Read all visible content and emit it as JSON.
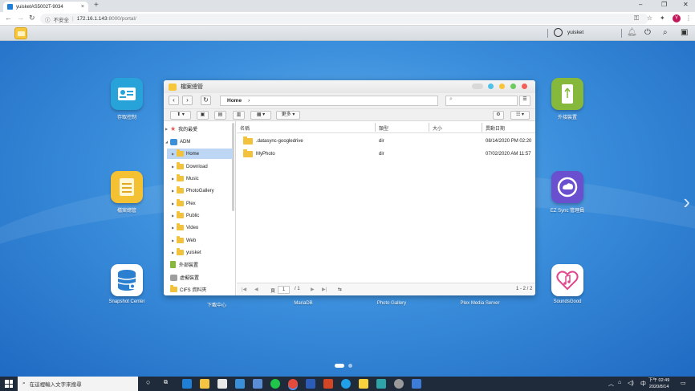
{
  "browser": {
    "tab_title": "yuisketAS5002T-9034",
    "tab_close": "×",
    "new_tab": "+",
    "security_label": "不安全",
    "url_host": "172.16.1.143",
    "url_path": ":8000/portal/",
    "profile_initial": "Y",
    "win_controls": [
      "–",
      "❐",
      "✕"
    ]
  },
  "adm": {
    "username": "yuisket"
  },
  "desktop": {
    "apps": [
      {
        "label": "存取控制",
        "color": "#27a3d9"
      },
      {
        "label": "檔案總管",
        "color": "#f4c132"
      },
      {
        "label": "Snapshot Center",
        "color": "#2a7fd1"
      },
      {
        "label": "外接裝置",
        "color": "#86b83c"
      },
      {
        "label": "EZ Sync 管理員",
        "color": "#6a4fcf"
      },
      {
        "label": "SoundsGood",
        "color": "#ffffff"
      },
      {
        "label": "下載中心",
        "color": ""
      },
      {
        "label": "MariaDB",
        "color": ""
      },
      {
        "label": "Photo Gallery",
        "color": ""
      },
      {
        "label": "Plex Media Server",
        "color": ""
      }
    ],
    "next_arrow": "›"
  },
  "explorer": {
    "title": "檔案總管",
    "path_label": "Home",
    "path_arrow": "›",
    "more_button": "更多",
    "tree": [
      {
        "label": "我的最愛",
        "level": 0,
        "selected": false,
        "kind": "star"
      },
      {
        "label": "ADM",
        "level": 0,
        "selected": false,
        "kind": "adm"
      },
      {
        "label": "Home",
        "level": 1,
        "selected": true,
        "kind": "folder"
      },
      {
        "label": "Download",
        "level": 1,
        "selected": false,
        "kind": "folder"
      },
      {
        "label": "Music",
        "level": 1,
        "selected": false,
        "kind": "folder"
      },
      {
        "label": "PhotoGallery",
        "level": 1,
        "selected": false,
        "kind": "folder"
      },
      {
        "label": "Plex",
        "level": 1,
        "selected": false,
        "kind": "folder"
      },
      {
        "label": "Public",
        "level": 1,
        "selected": false,
        "kind": "folder"
      },
      {
        "label": "Video",
        "level": 1,
        "selected": false,
        "kind": "folder"
      },
      {
        "label": "Web",
        "level": 1,
        "selected": false,
        "kind": "folder"
      },
      {
        "label": "yuisket",
        "level": 1,
        "selected": false,
        "kind": "folder"
      },
      {
        "label": "外部裝置",
        "level": 0,
        "selected": false,
        "kind": "ext"
      },
      {
        "label": "虛擬裝置",
        "level": 0,
        "selected": false,
        "kind": "virt"
      },
      {
        "label": "CIFS 資料夾",
        "level": 0,
        "selected": false,
        "kind": "cifs"
      }
    ],
    "columns": {
      "name": "名稱",
      "type": "類型",
      "size": "大小",
      "modified": "異動日期"
    },
    "rows": [
      {
        "name": ".datasync-googledrive",
        "type": "dir",
        "size": "",
        "modified": "08/14/2020 PM 02:20"
      },
      {
        "name": "MyPhoto",
        "type": "dir",
        "size": "",
        "modified": "07/02/2020 AM 11:57"
      }
    ],
    "pager": {
      "page_label": "頁",
      "page": "1",
      "total": "/ 1",
      "range": "1 - 2 / 2"
    }
  },
  "taskbar": {
    "search_placeholder": "在這裡輸入文字來搜尋",
    "time": "下午 02:49",
    "date": "2020/8/14",
    "ime": "中"
  }
}
